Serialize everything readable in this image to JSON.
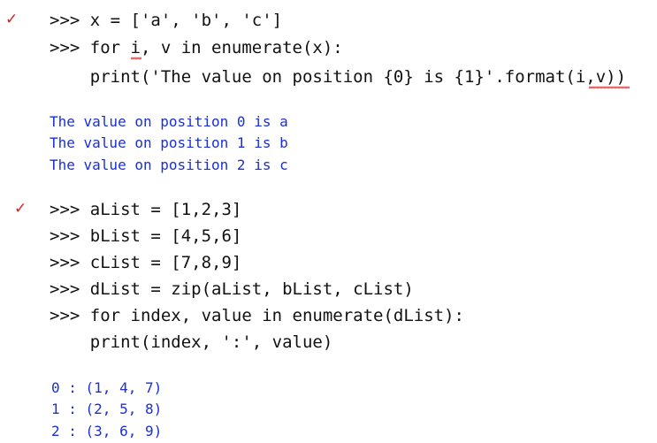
{
  "block1": {
    "check": "✓",
    "lines": [
      ">>> x = ['a', 'b', 'c']",
      ">>> for i, v in enumerate(x):",
      "    print('The value on position {0} is {1}'.format(i,v))"
    ],
    "output": [
      "The value on position 0 is a",
      "The value on position 1 is b",
      "The value on position 2 is c"
    ]
  },
  "block2": {
    "check": "✓",
    "lines": [
      ">>> aList = [1,2,3]",
      ">>> bList = [4,5,6]",
      ">>> cList = [7,8,9]",
      ">>> dList = zip(aList, bList, cList)",
      ">>> for index, value in enumerate(dList):",
      "    print(index, ':', value)"
    ],
    "output": [
      "0 : (1, 4, 7)",
      "1 : (2, 5, 8)",
      "2 : (3, 6, 9)"
    ]
  },
  "colors": {
    "code": "#111111",
    "output": "#1a2fd4",
    "check": "#d21f1f",
    "squiggle": "#dd2222"
  }
}
